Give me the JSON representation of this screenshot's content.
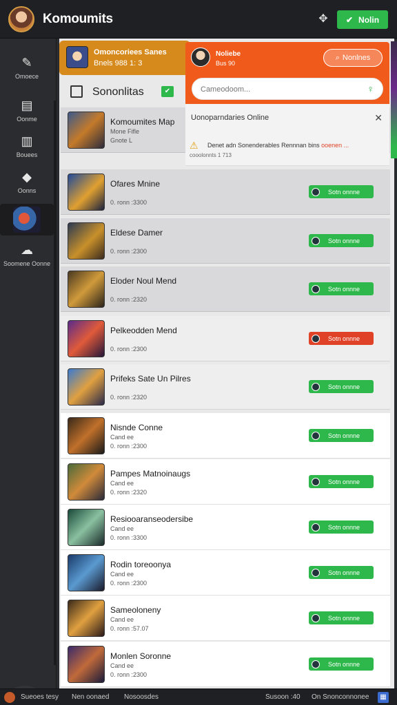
{
  "header": {
    "title": "Komoumits",
    "action_label": "Nolin"
  },
  "sidebar": {
    "items": [
      {
        "label": "Omoece",
        "icon": "feather-icon"
      },
      {
        "label": "Oonme",
        "icon": "book-icon"
      },
      {
        "label": "Bouees",
        "icon": "books-icon"
      },
      {
        "label": "Oonns",
        "icon": "gem-icon"
      },
      {
        "label": "",
        "icon": "game-thumb"
      },
      {
        "label": "Soomene Oonne",
        "icon": "cloud-icon"
      }
    ]
  },
  "featured": {
    "title": "Omoncoriees Sanes",
    "subtitle": "Bnels 988 1: 3"
  },
  "section": {
    "label": "Sononlitas"
  },
  "popup": {
    "user_name": "Noliebe",
    "user_status": "Bus 90",
    "pill_label": "Nonlnes",
    "search_placeholder": "Cameodoom...",
    "title": "Uonoparndaries Online",
    "message_prefix": "Denet adn Sonenderables Rennnan bins",
    "message_highlight": "ooenen ...",
    "meta": "cooolonnts 1 713"
  },
  "games": [
    {
      "name": "Komoumites Map",
      "meta1": "Mone Fifle",
      "meta2": "Gnote L",
      "button": "",
      "variant": "dim"
    },
    {
      "name": "Ofares Mnine",
      "meta1": "",
      "meta2": "0. ronn :3300",
      "button": "Sotn onnne",
      "variant": "dim"
    },
    {
      "name": "Eldese Damer",
      "meta1": "",
      "meta2": "0. ronn :2300",
      "button": "Sotn onnne",
      "variant": "dim"
    },
    {
      "name": "Eloder Noul Mend",
      "meta1": "",
      "meta2": "0. ronn :2320",
      "button": "Sotn onnne",
      "variant": "dim"
    },
    {
      "name": "Pelkeodden Mend",
      "meta1": "",
      "meta2": "0. ronn :2300",
      "button": "Sotn onnne",
      "variant": "normal",
      "red": true
    },
    {
      "name": "Prifeks Sate Un Pilres",
      "meta1": "",
      "meta2": "0. ronn :2320",
      "button": "Sotn onnne",
      "variant": "normal"
    },
    {
      "name": "Nisnde Conne",
      "meta1": "Cand ee",
      "meta2": "0. ronn :2300",
      "button": "Sotn onnne",
      "variant": "white"
    },
    {
      "name": "Pampes Matnoinaugs",
      "meta1": "Cand ee",
      "meta2": "0. ronn :2320",
      "button": "Sotn onnne",
      "variant": "white"
    },
    {
      "name": "Resiooaranseodersibe",
      "meta1": "Cand ee",
      "meta2": "0. ronn :3300",
      "button": "Sotn onnne",
      "variant": "white"
    },
    {
      "name": "Rodin toreoonya",
      "meta1": "Cand ee",
      "meta2": "0. ronn :2300",
      "button": "Sotn onnne",
      "variant": "white"
    },
    {
      "name": "Sameoloneny",
      "meta1": "Cand ee",
      "meta2": "0. ronn :57.07",
      "button": "Sotn onnne",
      "variant": "white"
    },
    {
      "name": "Monlen Soronne",
      "meta1": "Cand ee",
      "meta2": "0. ronn :2300",
      "button": "Sotn onnne",
      "variant": "white"
    }
  ],
  "bottombar": {
    "items": [
      "Sueoes tesy",
      "Nen oonaed",
      "Nosoosdes",
      "Susoon :40",
      "On Snonconnonee"
    ]
  },
  "colors": {
    "accent_green": "#2eb84b",
    "accent_orange": "#f05a1a",
    "accent_red": "#e04227",
    "featured_bg": "#d78a1c"
  }
}
